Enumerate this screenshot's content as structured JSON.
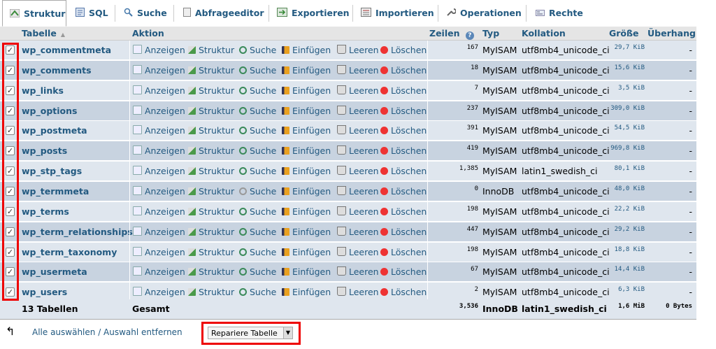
{
  "tabs": [
    {
      "label": "Struktur",
      "icon": "structure-icon",
      "active": true
    },
    {
      "label": "SQL",
      "icon": "sql-icon",
      "active": false
    },
    {
      "label": "Suche",
      "icon": "search-icon",
      "active": false
    },
    {
      "label": "Abfrageeditor",
      "icon": "query-editor-icon",
      "active": false
    },
    {
      "label": "Exportieren",
      "icon": "export-icon",
      "active": false
    },
    {
      "label": "Importieren",
      "icon": "import-icon",
      "active": false
    },
    {
      "label": "Operationen",
      "icon": "wrench-icon",
      "active": false
    },
    {
      "label": "Rechte",
      "icon": "privileges-icon",
      "active": false
    }
  ],
  "headers": {
    "tabelle": "Tabelle",
    "aktion": "Aktion",
    "zeilen": "Zeilen",
    "typ": "Typ",
    "kollation": "Kollation",
    "groesse": "Größe",
    "ueberhang": "Überhang"
  },
  "actions": {
    "anzeigen": "Anzeigen",
    "struktur": "Struktur",
    "suche": "Suche",
    "einfuegen": "Einfügen",
    "leeren": "Leeren",
    "loeschen": "Löschen"
  },
  "rows": [
    {
      "name": "wp_commentmeta",
      "rows": "167",
      "type": "MyISAM",
      "collation": "utf8mb4_unicode_ci",
      "size": "29,7 KiB",
      "overhead": "-",
      "checked": true
    },
    {
      "name": "wp_comments",
      "rows": "18",
      "type": "MyISAM",
      "collation": "utf8mb4_unicode_ci",
      "size": "15,6 KiB",
      "overhead": "-",
      "checked": true
    },
    {
      "name": "wp_links",
      "rows": "7",
      "type": "MyISAM",
      "collation": "utf8mb4_unicode_ci",
      "size": "3,5 KiB",
      "overhead": "-",
      "checked": true
    },
    {
      "name": "wp_options",
      "rows": "237",
      "type": "MyISAM",
      "collation": "utf8mb4_unicode_ci",
      "size": "309,0 KiB",
      "overhead": "-",
      "checked": true
    },
    {
      "name": "wp_postmeta",
      "rows": "391",
      "type": "MyISAM",
      "collation": "utf8mb4_unicode_ci",
      "size": "54,5 KiB",
      "overhead": "-",
      "checked": true
    },
    {
      "name": "wp_posts",
      "rows": "419",
      "type": "MyISAM",
      "collation": "utf8mb4_unicode_ci",
      "size": "969,8 KiB",
      "overhead": "-",
      "checked": true
    },
    {
      "name": "wp_stp_tags",
      "rows": "1,385",
      "type": "MyISAM",
      "collation": "latin1_swedish_ci",
      "size": "80,1 KiB",
      "overhead": "-",
      "checked": true
    },
    {
      "name": "wp_termmeta",
      "rows": "0",
      "type": "InnoDB",
      "collation": "utf8mb4_unicode_ci",
      "size": "48,0 KiB",
      "overhead": "-",
      "checked": true
    },
    {
      "name": "wp_terms",
      "rows": "198",
      "type": "MyISAM",
      "collation": "utf8mb4_unicode_ci",
      "size": "22,2 KiB",
      "overhead": "-",
      "checked": true
    },
    {
      "name": "wp_term_relationships",
      "rows": "447",
      "type": "MyISAM",
      "collation": "utf8mb4_unicode_ci",
      "size": "29,2 KiB",
      "overhead": "-",
      "checked": true
    },
    {
      "name": "wp_term_taxonomy",
      "rows": "198",
      "type": "MyISAM",
      "collation": "utf8mb4_unicode_ci",
      "size": "18,8 KiB",
      "overhead": "-",
      "checked": true
    },
    {
      "name": "wp_usermeta",
      "rows": "67",
      "type": "MyISAM",
      "collation": "utf8mb4_unicode_ci",
      "size": "14,4 KiB",
      "overhead": "-",
      "checked": true
    },
    {
      "name": "wp_users",
      "rows": "2",
      "type": "MyISAM",
      "collation": "utf8mb4_unicode_ci",
      "size": "6,3 KiB",
      "overhead": "-",
      "checked": true
    }
  ],
  "footer": {
    "count": "13 Tabellen",
    "gesamt": "Gesamt",
    "rows": "3,536",
    "type": "InnoDB",
    "collation": "latin1_swedish_ci",
    "size": "1,6 MiB",
    "overhead": "0 Bytes"
  },
  "bottom": {
    "select_all": "Alle auswählen / Auswahl entfernen",
    "dropdown_value": "Repariere Tabelle"
  },
  "colors": {
    "link": "#235a81",
    "highlight": "#ee0000",
    "row_a": "#dfe6ee",
    "row_b": "#c8d3e0"
  }
}
